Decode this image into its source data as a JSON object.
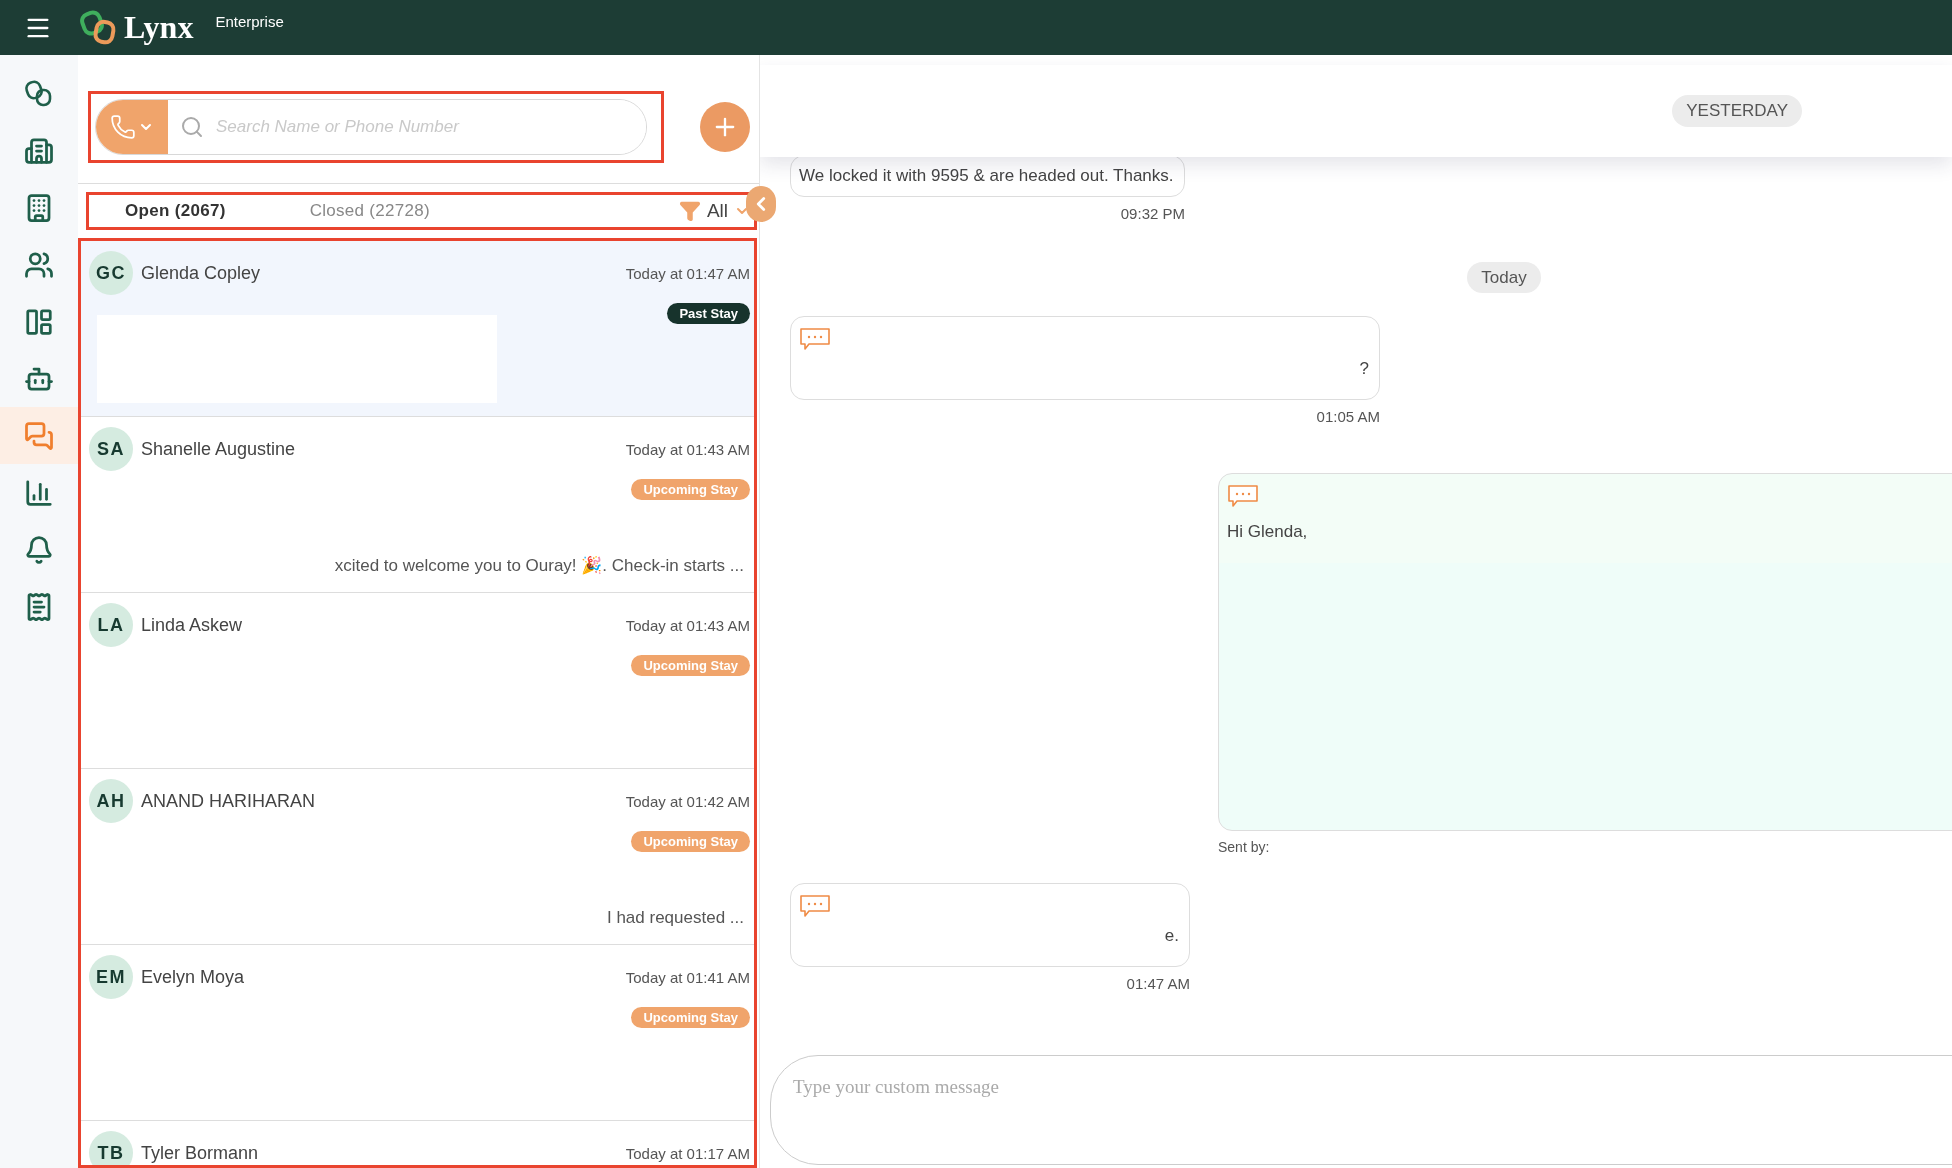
{
  "top_bar": {
    "brand": "Lynx",
    "edition": "Enterprise"
  },
  "sidebar": {
    "items": [
      {
        "kind": "rings",
        "selected": false
      },
      {
        "kind": "building",
        "selected": false
      },
      {
        "kind": "buildings",
        "selected": false
      },
      {
        "kind": "people",
        "selected": false
      },
      {
        "kind": "layout",
        "selected": false
      },
      {
        "kind": "bot",
        "selected": false
      },
      {
        "kind": "chat",
        "selected": true
      },
      {
        "kind": "chart",
        "selected": false
      },
      {
        "kind": "bell",
        "selected": false
      },
      {
        "kind": "invoice",
        "selected": false
      }
    ]
  },
  "search": {
    "placeholder": "Search Name or Phone Number",
    "highlighted": true
  },
  "tabs": {
    "highlighted": true,
    "items": [
      {
        "label": "Open (2067)",
        "selected": true
      },
      {
        "label": "Closed (22728)",
        "selected": false
      }
    ],
    "filter": "All"
  },
  "conversations": {
    "highlighted": true,
    "items": [
      {
        "initials": "GC",
        "name": "Glenda Copley",
        "time": "Today at 01:47 AM",
        "stay": {
          "label": "Past Stay",
          "kind": "past"
        },
        "selected": true,
        "redacted": true
      },
      {
        "initials": "SA",
        "name": "Shanelle Augustine",
        "time": "Today at 01:43 AM",
        "stay": {
          "label": "Upcoming Stay",
          "kind": "upcoming"
        },
        "snippet": "xcited to welcome you to Ouray! 🎉. Check-in starts ...",
        "selected": false,
        "redacted": false
      },
      {
        "initials": "LA",
        "name": "Linda Askew",
        "time": "Today at 01:43 AM",
        "stay": {
          "label": "Upcoming Stay",
          "kind": "upcoming"
        },
        "selected": false,
        "redacted": false
      },
      {
        "initials": "AH",
        "name": "ANAND HARIHARAN",
        "time": "Today at 01:42 AM",
        "stay": {
          "label": "Upcoming Stay",
          "kind": "upcoming"
        },
        "snippet": "I had requested ...",
        "selected": false,
        "redacted": false
      },
      {
        "initials": "EM",
        "name": "Evelyn Moya",
        "time": "Today at 01:41 AM",
        "stay": {
          "label": "Upcoming Stay",
          "kind": "upcoming"
        },
        "selected": false,
        "redacted": false
      },
      {
        "initials": "TB",
        "name": "Tyler Bormann",
        "time": "Today at 01:17 AM",
        "selected": false,
        "redacted": false
      }
    ]
  },
  "chat": {
    "header_date": "YESTERDAY",
    "items": [
      {
        "kind": "incoming",
        "sms": false,
        "text": "We locked it with 9595 & are headed out. Thanks.",
        "time": "09:32 PM"
      },
      {
        "kind": "date",
        "text": "Today"
      },
      {
        "kind": "incoming",
        "sms": true,
        "text": "?",
        "time": "01:05 AM"
      },
      {
        "kind": "outgoing",
        "sms": true,
        "text": "Hi Glenda,",
        "footer": "Sent by:"
      },
      {
        "kind": "incoming",
        "sms": true,
        "text": "e.",
        "time": "01:47 AM"
      }
    ],
    "composer": {
      "placeholder": "Type your custom message"
    }
  }
}
